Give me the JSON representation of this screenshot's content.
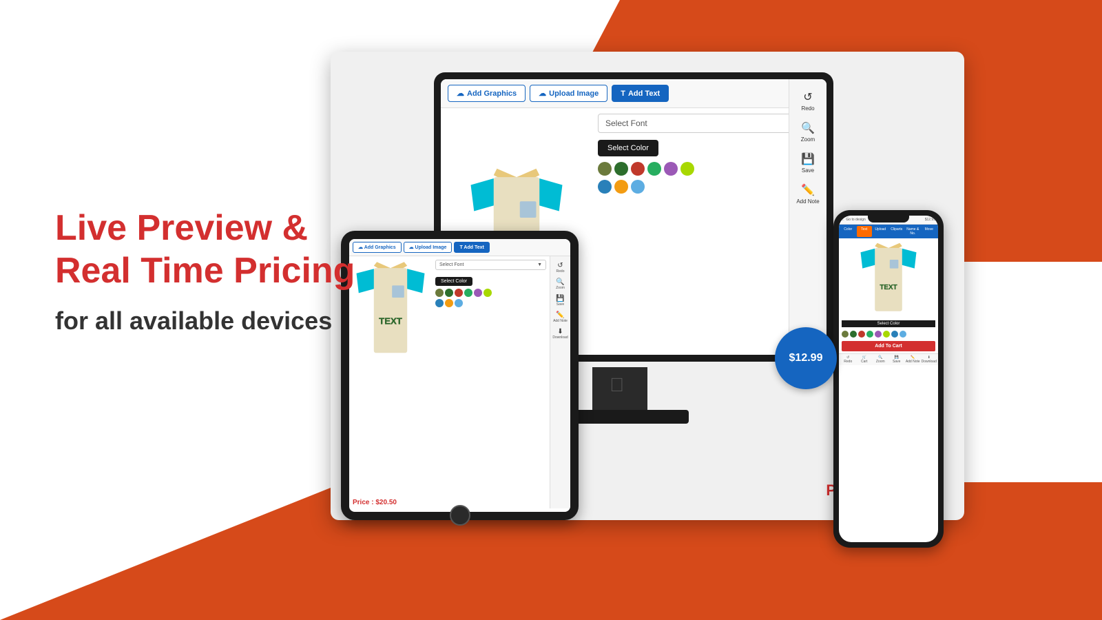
{
  "background": {
    "top_right_color": "#d64a1a",
    "bottom_color": "#d64a1a"
  },
  "left_section": {
    "line1": "Live Preview  &",
    "line2": "Real Time Pricing",
    "subtitle": "for all available devices"
  },
  "desktop": {
    "btn_graphics": "Add Graphics",
    "btn_upload": "Upload Image",
    "btn_addtext": "Add Text",
    "font_select_placeholder": "Select Font",
    "color_select_label": "Select Color",
    "price": "Price : $20.50",
    "sidebar_items": [
      {
        "label": "Redo",
        "icon": "↺"
      },
      {
        "label": "Zoom",
        "icon": "🔍"
      },
      {
        "label": "Save",
        "icon": "💾"
      },
      {
        "label": "Add Note",
        "icon": "✏️"
      }
    ],
    "color_swatches_row1": [
      "#6b7a3c",
      "#2d6e2d",
      "#c0392b",
      "#27ae60",
      "#9b59b6",
      "#a8d800"
    ],
    "color_swatches_row2": [
      "#2980b9",
      "#f39c12",
      "#5dade2"
    ]
  },
  "ipad": {
    "btn_graphics": "Add Graphics",
    "btn_upload": "Upload Image",
    "btn_addtext": "Add Text",
    "font_select_placeholder": "Select Font",
    "color_select_label": "Select Color",
    "price": "Price : $20.50",
    "color_swatches_row1": [
      "#6b7a3c",
      "#2d6e2d",
      "#c0392b",
      "#27ae60",
      "#9b59b6",
      "#a8d800"
    ],
    "color_swatches_row2": [
      "#2980b9",
      "#f39c12",
      "#5dade2"
    ]
  },
  "iphone": {
    "add_to_cart": "Add To Cart",
    "select_color": "Select Color",
    "cart_badge": "Add to Cart",
    "price_badge": "$12.99",
    "color_swatches": [
      "#6b7a3c",
      "#2d6e2d",
      "#c0392b",
      "#27ae60",
      "#9b59b6",
      "#a8d800",
      "#2980b9",
      "#5dade2"
    ],
    "tabs": [
      "Color",
      "Text",
      "Upload",
      "Cliparts",
      "Name & Number",
      "Move"
    ],
    "bottom_icons": [
      "Redo",
      "Cart",
      "Zoom",
      "Save",
      "Add Note",
      "Download"
    ]
  }
}
